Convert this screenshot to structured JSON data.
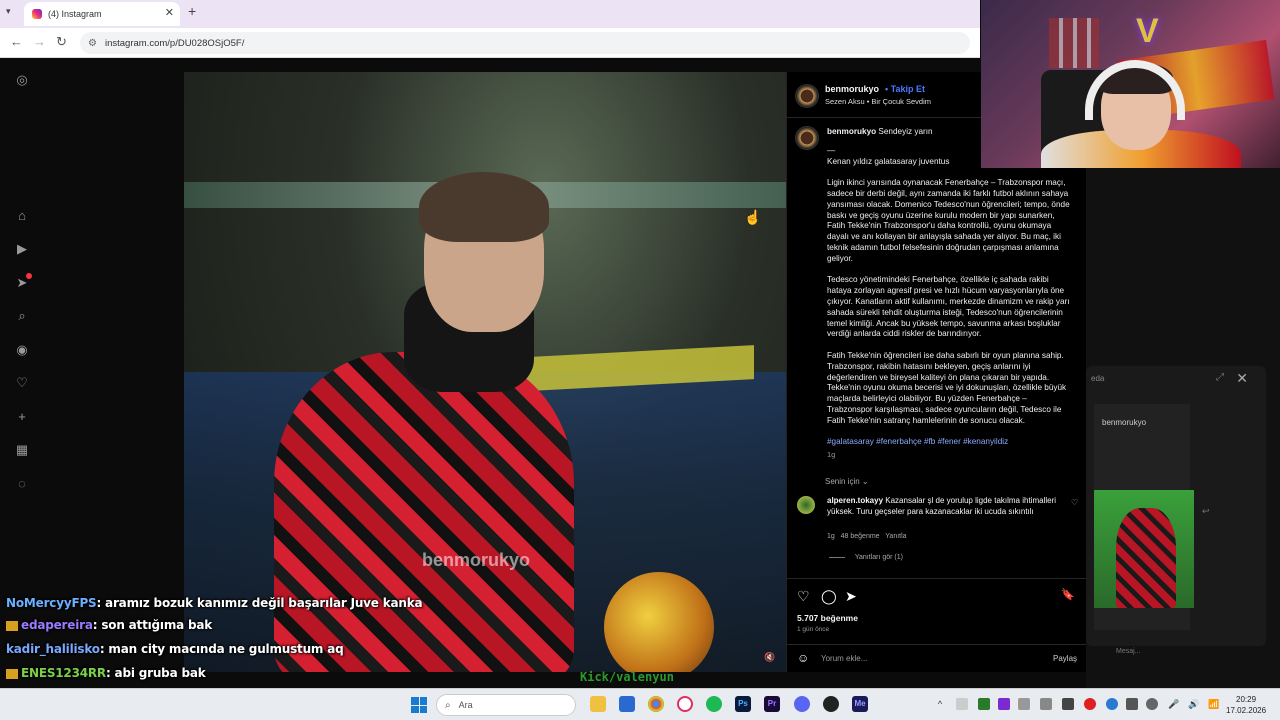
{
  "browser": {
    "tab_title": "(4) Instagram",
    "url": "instagram.com/p/DU028OSjO5F/"
  },
  "icons": {
    "tab_menu": "▾",
    "close": "✕",
    "new_tab": "+",
    "back": "←",
    "forward": "→",
    "reload": "↻",
    "site_info": "⚙",
    "instagram": "◎",
    "home": "⌂",
    "reels": "▶",
    "messages": "➤",
    "search": "⌕",
    "explore": "◉",
    "notifications": "♡",
    "create": "+",
    "dashboard": "▦",
    "meta": "◌",
    "like": "♡",
    "comment": "◯",
    "share": "➤",
    "save": "🔖",
    "emoji": "☺",
    "mute": "🔇",
    "heart_small": "♡",
    "expand": "⤢",
    "reply": "↩",
    "search_glass": "⌕",
    "bell": "🔔",
    "cursor": "☝"
  },
  "post": {
    "username": "benmorukyo",
    "follow_label": "Takip Et",
    "dot": "•",
    "music": "Sezen Aksu • Bir Çocuk Sevdim",
    "caption_user": "benmorukyo",
    "caption_lead": "Sendeyiz yarın",
    "caption_dash": "—",
    "caption_line2": "Kenan yıldız galatasaray juventus",
    "para1": "Ligin ikinci yarısında oynanacak Fenerbahçe – Trabzonspor maçı, sadece bir derbi değil, aynı zamanda iki farklı futbol aklının sahaya yansıması olacak. Domenico Tedesco'nun öğrencileri; tempo, önde baskı ve geçiş oyunu üzerine kurulu modern bir yapı sunarken, Fatih Tekke'nin Trabzonspor'u daha kontrollü, oyunu okumaya dayalı ve anı kollayan bir anlayışla sahada yer alıyor. Bu maç, iki teknik adamın futbol felsefesinin doğrudan çarpışması anlamına geliyor.",
    "para2": "Tedesco yönetimindeki Fenerbahçe, özellikle iç sahada rakibi hataya zorlayan agresif presi ve hızlı hücum varyasyonlarıyla öne çıkıyor. Kanatların aktif kullanımı, merkezde dinamizm ve rakip yarı sahada sürekli tehdit oluşturma isteği, Tedesco'nun öğrencilerinin temel kimliği. Ancak bu yüksek tempo, savunma arkası boşluklar verdiği anlarda ciddi riskler de barındırıyor.",
    "para3": "Fatih Tekke'nin öğrencileri ise daha sabırlı bir oyun planına sahip. Trabzonspor, rakibin hatasını bekleyen, geçiş anlarını iyi değerlendiren ve bireysel kaliteyi ön plana çıkaran bir yapıda. Tekke'nin oyunu okuma becerisi ve iyi dokunuşları, özellikle büyük maçlarda belirleyici olabiliyor. Bu yüzden Fenerbahçe – Trabzonspor karşılaşması, sadece oyuncuların değil, Tedesco ile Fatih Tekke'nin satranç hamlelerinin de sonucu olacak.",
    "hashtags": "#galatasaray #fenerbahçe #fb #fener #kenanyildiz",
    "caption_age": "1g",
    "for_you": "Senin için ⌄",
    "comment_user": "alperen.tokayy",
    "comment_text": "Kazansalar şl de yorulup ligde takılma ihtimalleri yüksek. Turu geçseler para kazanacaklar iki ucuda sıkıntılı",
    "comment_age": "1g",
    "comment_likes": "48 beğenme",
    "comment_reply": "Yanıtla",
    "view_replies": "Yanıtları gör (1)",
    "likes": "5.707 beğenme",
    "posted": "1 gün önce",
    "comment_placeholder": "Yorum ekle...",
    "share_label": "Paylaş",
    "watermark": "benmorukyo"
  },
  "mini_panel": {
    "label": "eda",
    "card_user": "benmorukyo",
    "message_placeholder": "Mesaj..."
  },
  "chat": [
    {
      "user": "NoMercyyFPS",
      "text": ": aramız bozuk kanımız değil başarılar Juve kanka",
      "user_color": "#6ab0ff",
      "badge": false
    },
    {
      "user": "edapereira",
      "text": ": son attığıma bak",
      "user_color": "#9a7aff",
      "badge": true
    },
    {
      "user": "kadir_halilisko",
      "text": ": man city macında ne gulmustum aq",
      "user_color": "#7aa8ff",
      "badge": false
    },
    {
      "user": "ENES1234RR",
      "text": ": abi gruba bak",
      "user_color": "#7ad04a",
      "badge": true
    }
  ],
  "stream": {
    "kick_handle": "Kick/valenyun"
  },
  "taskbar": {
    "search_label": "Ara",
    "time": "20:29",
    "date": "17.02.2026"
  },
  "colors": {
    "follow_blue": "#4a7aff",
    "hashtag": "#8fa8ff",
    "instagram_bg": "#000000"
  }
}
